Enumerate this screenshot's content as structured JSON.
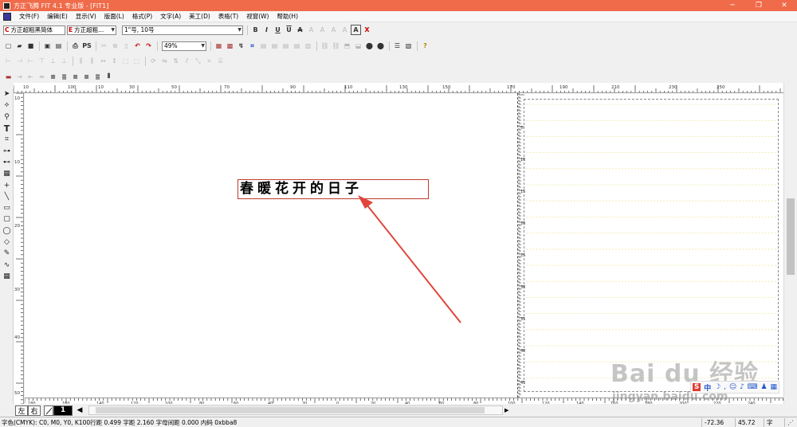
{
  "titlebar": {
    "title": "方正飞腾 FIT 4.1 专业版 - [FIT1]",
    "minimize": "─",
    "restore": "❐",
    "close": "✕"
  },
  "menu": {
    "items": [
      "文件(F)",
      "编辑(E)",
      "显示(V)",
      "版面(L)",
      "格式(P)",
      "文字(A)",
      "美工(D)",
      "表格(T)",
      "视窗(W)",
      "帮助(H)"
    ]
  },
  "toolbar1": {
    "c_font_prefix": "C",
    "c_font": "方正超粗黑简体",
    "e_font_prefix": "E",
    "e_font": "方正超粗...",
    "size": "1\"号, 10号",
    "style_buttons": [
      "B",
      "I",
      "U",
      "U",
      "A",
      "A",
      "A",
      "A",
      "A",
      "A",
      "X"
    ]
  },
  "toolbar2": {
    "ps_label": "PS",
    "zoom": "49%"
  },
  "rulers": {
    "top_labels": [
      "10",
      "100",
      "10",
      "30",
      "50",
      "70",
      "90",
      "110",
      "130",
      "150",
      "170",
      "190",
      "210",
      "230",
      "250"
    ],
    "left_labels": [
      "10",
      "10",
      "20",
      "30",
      "40",
      "50"
    ],
    "board_labels": [
      "5",
      "10",
      "15",
      "20",
      "25",
      "30",
      "35",
      "40",
      "45"
    ],
    "bottom_labels": [
      "180",
      "160",
      "140",
      "120",
      "100",
      "80",
      "60",
      "40",
      "20",
      "0",
      "20",
      "40",
      "60",
      "80",
      "100",
      "120",
      "140",
      "160",
      "180",
      "200",
      "220",
      "240"
    ]
  },
  "canvas": {
    "text": "春暖花开的日子",
    "frame_color": "#c0392b",
    "arrow_color": "#e0463c"
  },
  "pagebar": {
    "left_btn": "左",
    "right_btn": "右",
    "page_num": "1"
  },
  "status": {
    "info": "字色(CMYK): C0, M0, Y0, K100行距 0.499 字距 2.160 字母间距 0.000 内码 0xbba8",
    "x": "-72.36",
    "y": "45.72",
    "unit": "字"
  },
  "watermark": {
    "brand": "Bai du 经验",
    "url": "jingyan.baidu.com"
  },
  "ime": {
    "lang": "中"
  }
}
